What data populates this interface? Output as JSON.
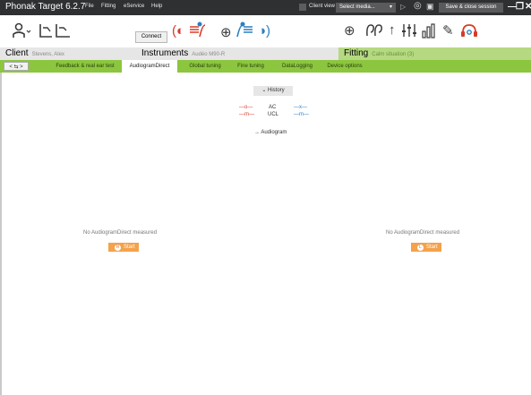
{
  "titlebar": {
    "app_title": "Phonak Target 6.2.7",
    "menus": [
      "File",
      "Fitting",
      "eService",
      "Help"
    ],
    "client_view": "Client view",
    "select_media": "Select media...",
    "save_close": "Save & close session",
    "window_controls": [
      "—",
      "❐",
      "✕"
    ]
  },
  "toolbar": {
    "connect_label": "Connect"
  },
  "sections": {
    "client": {
      "label": "Client",
      "value": "Stevens, Alex"
    },
    "instruments": {
      "label": "Instruments",
      "value": "Audéo M90-R"
    },
    "fitting": {
      "label": "Fitting",
      "value": "Calm situation (3)"
    }
  },
  "tabs": {
    "nav": "< ⇆ >",
    "items": [
      "Feedback & real ear test",
      "AudiogramDirect",
      "Global tuning",
      "Fine tuning",
      "DataLogging",
      "Device options"
    ],
    "active": "AudiogramDirect"
  },
  "content": {
    "history_label": "History",
    "legend": {
      "ac": "AC",
      "ucl": "UCL",
      "right_ac": "—o—",
      "right_ucl": "—m—",
      "left_ac": "—x—",
      "left_ucl": "—m—"
    },
    "audiogram_link": "→ Audiogram",
    "right_message": "No AudiogramDirect measured",
    "left_message": "No AudiogramDirect measured",
    "start_label": "Start",
    "right_badge": "R",
    "left_badge": "L"
  },
  "colors": {
    "titlebar_bg": "#2f3032",
    "green": "#8cc63f",
    "section_green": "#b5d981",
    "right_red": "#d83a2a",
    "left_blue": "#2a7fc1",
    "start_orange": "#f4a24b"
  }
}
